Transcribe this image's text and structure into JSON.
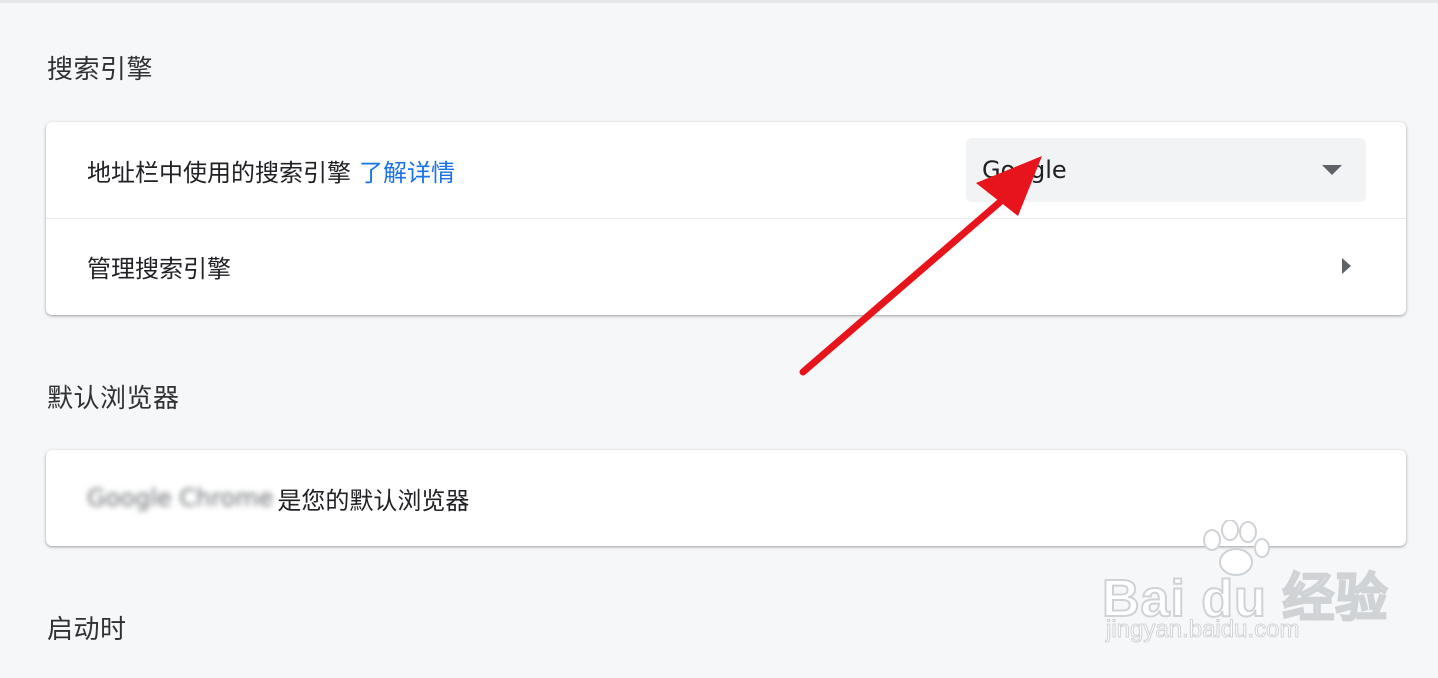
{
  "sections": {
    "search_engine": {
      "title": "搜索引擎",
      "address_bar_label": "地址栏中使用的搜索引擎",
      "learn_more_link": "了解详情",
      "selected_engine": "Google",
      "manage_label": "管理搜索引擎"
    },
    "default_browser": {
      "title": "默认浏览器",
      "browser_name": "Google Chrome",
      "status_text": "是您的默认浏览器"
    },
    "on_startup": {
      "title": "启动时"
    }
  },
  "overlay": {
    "arrow_color": "#e8141c"
  },
  "watermark": {
    "brand": "Bai du 经验",
    "url": "jingyan.baidu.com"
  },
  "icons": {
    "dropdown": "caret-down-icon",
    "chevron": "chevron-right-icon",
    "annotation": "red-arrow-icon",
    "watermark": "paw-print-icon"
  },
  "colors": {
    "link": "#1a73e8",
    "background": "#f6f7f9",
    "card": "#ffffff"
  }
}
